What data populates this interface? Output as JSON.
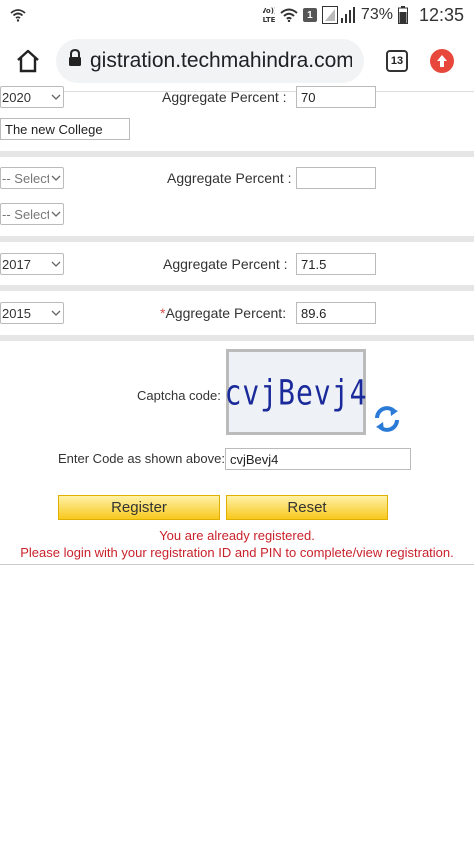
{
  "status_bar": {
    "volte_label": "Vo)) LTE",
    "sim_label": "1",
    "battery_percent": "73%",
    "time": "12:35"
  },
  "browser": {
    "url": "gistration.techmahindra.com",
    "tab_count": "13"
  },
  "form": {
    "row1": {
      "year": "2020",
      "label": "Aggregate Percent :",
      "value": "70"
    },
    "college": "The new College",
    "row2": {
      "year": "-- Select",
      "label": "Aggregate Percent :",
      "value": ""
    },
    "row3": {
      "year": "-- Select"
    },
    "row4": {
      "year": "2017",
      "label": "Aggregate Percent :",
      "value": "71.5"
    },
    "row5": {
      "year": "2015",
      "required_mark": "*",
      "label": "Aggregate Percent:",
      "value": "89.6"
    },
    "captcha_label": "Captcha code:",
    "captcha_text": "cvjBevj4",
    "enter_code_label": "Enter Code as shown above:",
    "entered_code": "cvjBevj4",
    "register_label": "Register",
    "reset_label": "Reset",
    "message_line1": "You are already registered.",
    "message_line2": "Please login with your registration ID and PIN to complete/view registration."
  },
  "colors": {
    "error_text": "#c9222b",
    "button_gradient_top": "#fff2a8",
    "button_gradient_bottom": "#f8c81d",
    "captcha_text": "#1b2a9a",
    "update_badge": "#e8473b"
  }
}
